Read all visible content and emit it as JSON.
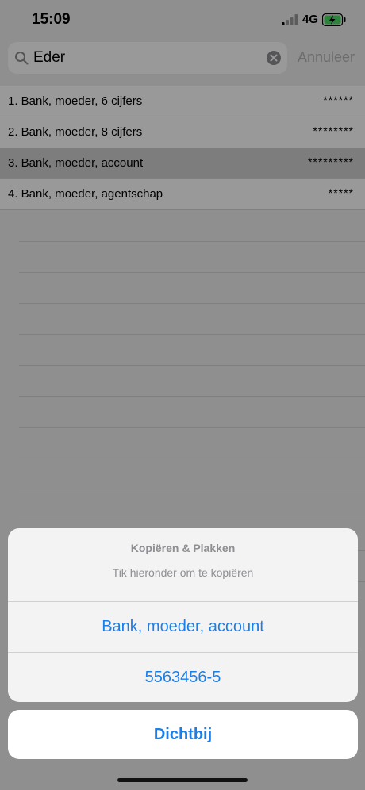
{
  "status": {
    "time": "15:09",
    "network": "4G"
  },
  "search": {
    "value": "Eder",
    "cancel_label": "Annuleer"
  },
  "results": [
    {
      "label": "1. Bank, moeder, 6 cijfers",
      "masked": "******",
      "selected": false
    },
    {
      "label": "2. Bank, moeder, 8 cijfers",
      "masked": "********",
      "selected": false
    },
    {
      "label": "3. Bank, moeder, account",
      "masked": "*********",
      "selected": true
    },
    {
      "label": "4. Bank, moeder, agentschap",
      "masked": "*****",
      "selected": false
    }
  ],
  "sheet": {
    "title": "Kopiëren & Plakken",
    "subtitle": "Tik hieronder om te kopiëren",
    "option_name": "Bank, moeder, account",
    "option_value": "5563456-5",
    "close_label": "Dichtbij"
  },
  "colors": {
    "accent": "#1a7fe8",
    "battery": "#4cd964"
  }
}
